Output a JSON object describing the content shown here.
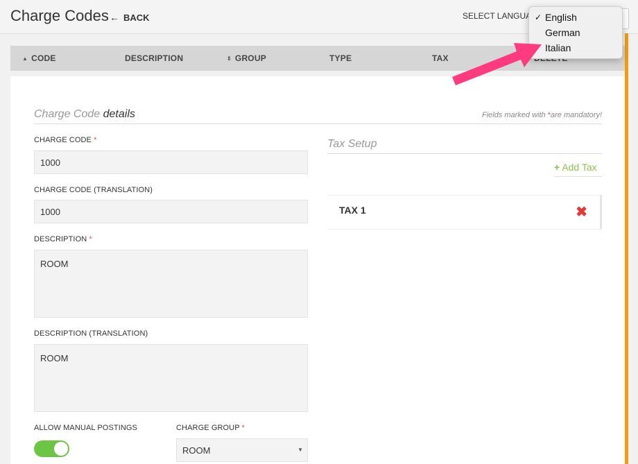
{
  "header": {
    "title": "Charge Codes",
    "back_label": "BACK",
    "select_language_label": "SELECT LANGUAGE"
  },
  "language_dropdown": {
    "options": [
      "English",
      "German",
      "Italian"
    ],
    "selected": "English",
    "check_glyph": "✓"
  },
  "table": {
    "columns": [
      "CODE",
      "DESCRIPTION",
      "GROUP",
      "TYPE",
      "TAX",
      "DELETE"
    ]
  },
  "details": {
    "section_title_light": "Charge Code",
    "section_title_strong": "details",
    "mandatory_prefix": "Fields marked with",
    "mandatory_star": "*",
    "mandatory_suffix": "are mandatory!",
    "charge_code_label": "CHARGE CODE",
    "charge_code_value": "1000",
    "charge_code_translation_label": "CHARGE CODE (TRANSLATION)",
    "charge_code_translation_value": "1000",
    "description_label": "DESCRIPTION",
    "description_value": "ROOM",
    "description_translation_label": "DESCRIPTION (TRANSLATION)",
    "description_translation_value": "ROOM",
    "allow_manual_postings_label": "ALLOW MANUAL POSTINGS",
    "charge_group_label": "CHARGE GROUP",
    "charge_group_value": "ROOM",
    "required_star": "*"
  },
  "tax_setup": {
    "title": "Tax Setup",
    "add_tax_label": "Add Tax",
    "add_icon": "+",
    "rows": [
      {
        "name": "TAX 1"
      }
    ],
    "delete_glyph": "✖"
  },
  "colors": {
    "accent_orange": "#f39c12",
    "toggle_green": "#6cc644",
    "add_green": "#8bc34a",
    "delete_red": "#e53935",
    "annotation_arrow": "#ff3b7f"
  },
  "toggle": {
    "allow_manual_postings": true
  }
}
